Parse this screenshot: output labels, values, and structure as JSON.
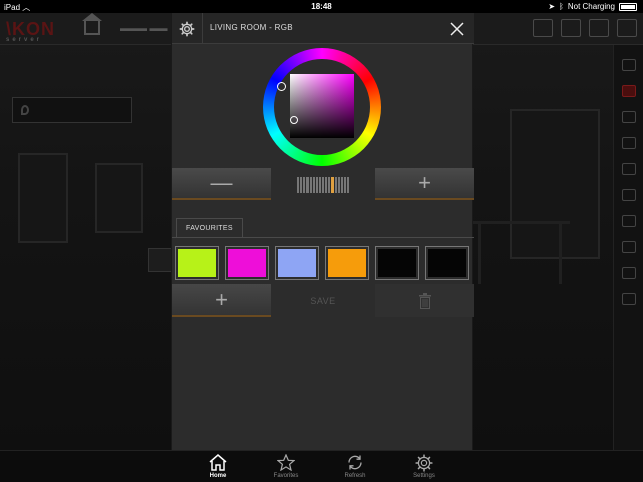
{
  "status_bar": {
    "device": "iPad",
    "time": "18:48",
    "charging": "Not Charging"
  },
  "modal": {
    "title": "LIVING ROOM - RGB",
    "selected_color": "#ff00ff",
    "brightness": {
      "minus_label": "—",
      "plus_label": "+"
    },
    "favourites_tab": "FAVOURITES",
    "favourites": [
      {
        "color": "#b7f218"
      },
      {
        "color": "#ee0ed9"
      },
      {
        "color": "#8ea5f4"
      },
      {
        "color": "#f69c0b"
      },
      {
        "color": "#050505"
      },
      {
        "color": "#050505"
      }
    ],
    "add_label": "+",
    "save_label": "SAVE"
  },
  "tabbar": {
    "items": [
      {
        "label": "Home",
        "icon": "home-icon",
        "active": true
      },
      {
        "label": "Favorites",
        "icon": "star-icon",
        "active": false
      },
      {
        "label": "Refresh",
        "icon": "refresh-icon",
        "active": false
      },
      {
        "label": "Settings",
        "icon": "gear-icon",
        "active": false
      }
    ]
  }
}
